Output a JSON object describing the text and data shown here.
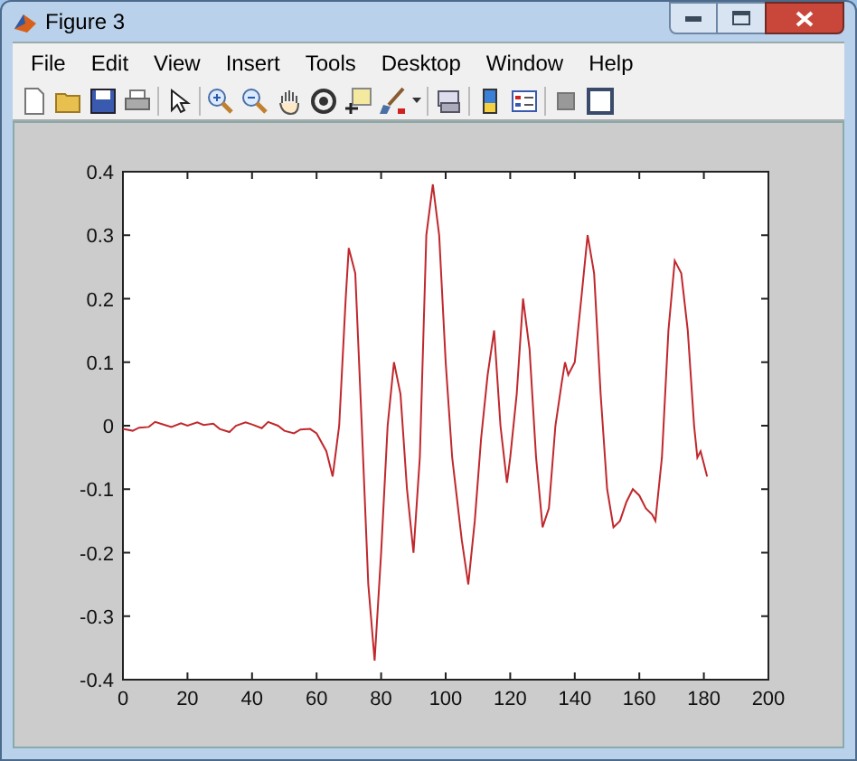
{
  "window": {
    "title": "Figure 3"
  },
  "menu": [
    "File",
    "Edit",
    "View",
    "Insert",
    "Tools",
    "Desktop",
    "Window",
    "Help"
  ],
  "axes": {
    "chart_data": {
      "type": "line",
      "xlim": [
        0,
        200
      ],
      "ylim": [
        -0.4,
        0.4
      ],
      "xticks": [
        0,
        20,
        40,
        60,
        80,
        100,
        120,
        140,
        160,
        180,
        200
      ],
      "yticks": [
        {
          "value": -0.4,
          "label": "-0.4"
        },
        {
          "value": -0.3,
          "label": "-0.3"
        },
        {
          "value": -0.2,
          "label": "-0.2"
        },
        {
          "value": -0.1,
          "label": "-0.1"
        },
        {
          "value": 0,
          "label": "0"
        },
        {
          "value": 0.1,
          "label": "0.1"
        },
        {
          "value": 0.2,
          "label": "0.2"
        },
        {
          "value": 0.3,
          "label": "0.3"
        },
        {
          "value": 0.4,
          "label": "0.4"
        }
      ],
      "x": [
        0,
        3,
        5,
        8,
        10,
        13,
        15,
        18,
        20,
        23,
        25,
        28,
        30,
        33,
        35,
        38,
        40,
        43,
        45,
        48,
        50,
        53,
        55,
        58,
        60,
        63,
        65,
        67,
        69,
        70,
        72,
        74,
        76,
        78,
        80,
        82,
        84,
        86,
        88,
        90,
        92,
        94,
        96,
        98,
        100,
        102,
        105,
        107,
        109,
        111,
        113,
        115,
        117,
        119,
        120,
        122,
        124,
        126,
        128,
        130,
        132,
        134,
        136,
        137,
        138,
        140,
        142,
        144,
        146,
        148,
        150,
        152,
        154,
        156,
        158,
        160,
        162,
        164,
        165,
        167,
        169,
        171,
        173,
        175,
        177,
        178,
        179,
        180,
        181
      ],
      "series": [
        {
          "color": "#c0282d",
          "values": [
            -0.005,
            -0.008,
            -0.003,
            -0.002,
            0.006,
            0.001,
            -0.002,
            0.004,
            0.0,
            0.005,
            0.001,
            0.003,
            -0.005,
            -0.01,
            0.0,
            0.005,
            0.002,
            -0.004,
            0.006,
            0.0,
            -0.008,
            -0.012,
            -0.006,
            -0.005,
            -0.012,
            -0.04,
            -0.08,
            0.0,
            0.2,
            0.28,
            0.24,
            0.0,
            -0.25,
            -0.37,
            -0.2,
            0.0,
            0.1,
            0.05,
            -0.1,
            -0.2,
            -0.05,
            0.3,
            0.38,
            0.3,
            0.1,
            -0.05,
            -0.18,
            -0.25,
            -0.15,
            -0.02,
            0.08,
            0.15,
            0.0,
            -0.09,
            -0.05,
            0.05,
            0.2,
            0.12,
            -0.05,
            -0.16,
            -0.13,
            0.0,
            0.07,
            0.1,
            0.08,
            0.1,
            0.2,
            0.3,
            0.24,
            0.05,
            -0.1,
            -0.16,
            -0.15,
            -0.12,
            -0.1,
            -0.11,
            -0.13,
            -0.14,
            -0.15,
            -0.05,
            0.15,
            0.26,
            0.24,
            0.15,
            0.0,
            -0.05,
            -0.04,
            -0.06,
            -0.08
          ]
        }
      ]
    }
  }
}
